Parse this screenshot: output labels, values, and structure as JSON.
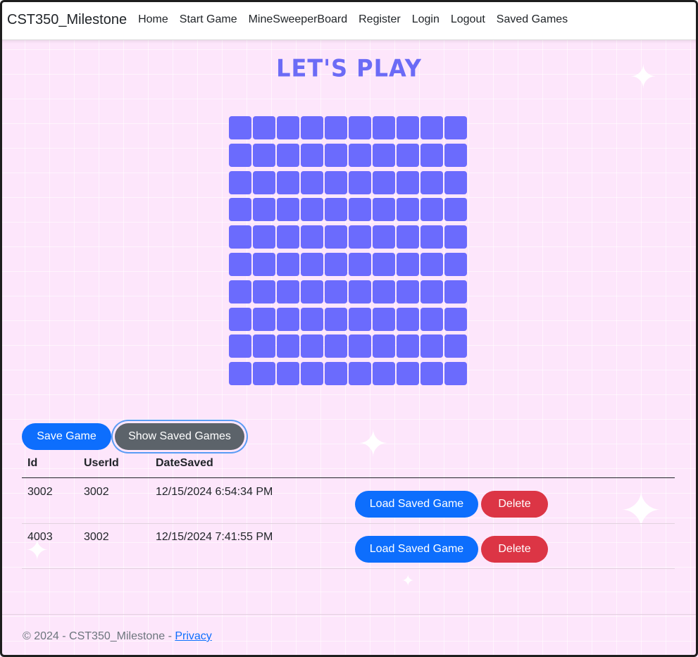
{
  "navbar": {
    "brand": "CST350_Milestone",
    "links": [
      "Home",
      "Start Game",
      "MineSweeperBoard",
      "Register",
      "Login",
      "Logout",
      "Saved Games"
    ]
  },
  "page": {
    "title": "LET'S PLAY"
  },
  "board": {
    "rows": 10,
    "cols": 10,
    "cell_color": "#6b6bfd"
  },
  "actions": {
    "save_label": "Save Game",
    "show_saved_label": "Show Saved Games"
  },
  "table": {
    "headers": [
      "Id",
      "UserId",
      "DateSaved"
    ],
    "rows": [
      {
        "id": "3002",
        "user_id": "3002",
        "date_saved": "12/15/2024 6:54:34 PM",
        "load_label": "Load Saved Game",
        "delete_label": "Delete"
      },
      {
        "id": "4003",
        "user_id": "3002",
        "date_saved": "12/15/2024 7:41:55 PM",
        "load_label": "Load Saved Game",
        "delete_label": "Delete"
      }
    ]
  },
  "footer": {
    "text": "© 2024 - CST350_Milestone - ",
    "privacy_label": "Privacy"
  },
  "colors": {
    "background": "#fde6fb",
    "accent": "#6b6bf6",
    "primary": "#0d6efd",
    "secondary": "#5c636a",
    "danger": "#dc3545"
  }
}
